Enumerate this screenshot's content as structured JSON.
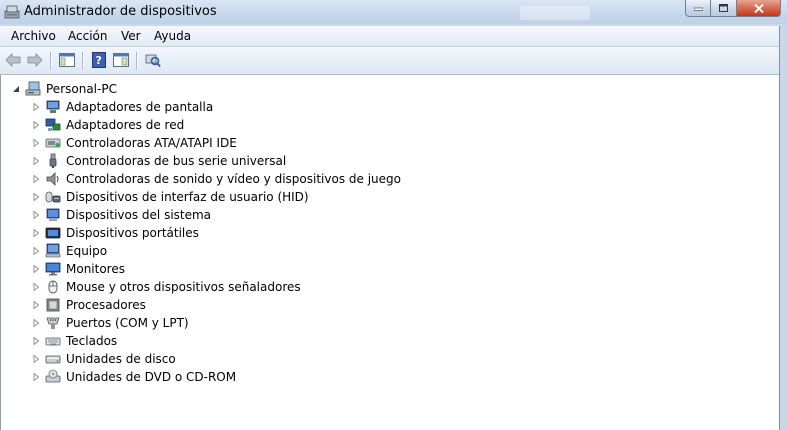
{
  "window": {
    "title": "Administrador de dispositivos"
  },
  "menu": [
    "Archivo",
    "Acción",
    "Ver",
    "Ayuda"
  ],
  "tree": {
    "root": "Personal-PC",
    "children": [
      {
        "label": "Adaptadores de pantalla",
        "icon": "display-adapter-icon"
      },
      {
        "label": "Adaptadores de red",
        "icon": "network-adapter-icon"
      },
      {
        "label": "Controladoras ATA/ATAPI IDE",
        "icon": "ide-controller-icon"
      },
      {
        "label": "Controladoras de bus serie universal",
        "icon": "usb-controller-icon"
      },
      {
        "label": "Controladoras de sonido y vídeo y dispositivos de juego",
        "icon": "sound-icon"
      },
      {
        "label": "Dispositivos de interfaz de usuario (HID)",
        "icon": "hid-icon"
      },
      {
        "label": "Dispositivos del sistema",
        "icon": "system-devices-icon"
      },
      {
        "label": "Dispositivos portátiles",
        "icon": "portable-devices-icon"
      },
      {
        "label": "Equipo",
        "icon": "computer-icon"
      },
      {
        "label": "Monitores",
        "icon": "monitor-icon"
      },
      {
        "label": "Mouse y otros dispositivos señaladores",
        "icon": "mouse-icon"
      },
      {
        "label": "Procesadores",
        "icon": "processor-icon"
      },
      {
        "label": "Puertos (COM y LPT)",
        "icon": "port-icon"
      },
      {
        "label": "Teclados",
        "icon": "keyboard-icon"
      },
      {
        "label": "Unidades de disco",
        "icon": "disk-drive-icon"
      },
      {
        "label": "Unidades de DVD o CD-ROM",
        "icon": "dvd-drive-icon"
      }
    ]
  }
}
